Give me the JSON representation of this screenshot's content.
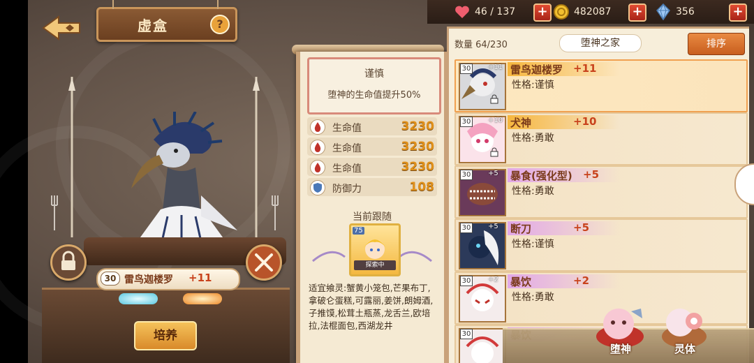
{
  "header": {
    "title": "虚盒",
    "help_glyph": "?"
  },
  "resources": [
    {
      "name": "stamina",
      "icon": "heart-icon",
      "value": "46 / 137",
      "color": "#ef5e6e"
    },
    {
      "name": "gold",
      "icon": "coin-icon",
      "value": "482087",
      "color": "#f2c030"
    },
    {
      "name": "crystal",
      "icon": "crystal-icon",
      "value": "356",
      "color": "#9ec8f4"
    }
  ],
  "character": {
    "level": "30",
    "name": "雷鸟迦楼罗",
    "plus": "+11",
    "train_label": "培养"
  },
  "detail": {
    "trait_name": "谨慎",
    "trait_desc": "堕神的生命值提升50%",
    "stats": [
      {
        "label": "生命值",
        "value": "3230",
        "icon": "blood-drop-icon"
      },
      {
        "label": "生命值",
        "value": "3230",
        "icon": "blood-drop-icon"
      },
      {
        "label": "生命值",
        "value": "3230",
        "icon": "blood-drop-icon"
      },
      {
        "label": "防御力",
        "value": "108",
        "icon": "shield-icon"
      }
    ],
    "follow_label": "当前跟随",
    "follow_level": "75",
    "follow_status": "探索中",
    "favor_text": "适宜飨灵:蟹黄小笼包,芒果布丁,拿破仑蛋糕,可露丽,姜饼,朗姆酒,子推馍,松茸土瓶蒸,龙舌兰,欧培拉,法棍面包,西湖龙井"
  },
  "list": {
    "count": "数量 64/230",
    "tab": "堕神之家",
    "sort_label": "排序",
    "items": [
      {
        "level": "30",
        "plus": "+11",
        "name": "雷鸟迦楼罗",
        "personality": "性格:谨慎",
        "color": "orange",
        "selected": true
      },
      {
        "level": "30",
        "plus": "+10",
        "name": "犬神",
        "personality": "性格:勇敢",
        "color": "orange",
        "selected": false
      },
      {
        "level": "30",
        "plus": "+5",
        "name": "暴食(强化型)",
        "personality": "性格:勇敢",
        "color": "purple",
        "selected": false
      },
      {
        "level": "30",
        "plus": "+5",
        "name": "断刀",
        "personality": "性格:谨慎",
        "color": "purple",
        "selected": false
      },
      {
        "level": "30",
        "plus": "+2",
        "name": "暴饮",
        "personality": "性格:勇敢",
        "color": "purple",
        "selected": false
      },
      {
        "level": "30",
        "plus": "",
        "name": "暴饮",
        "personality": "",
        "color": "purple",
        "selected": false
      }
    ]
  },
  "bottom_nav": {
    "deity_label": "堕神",
    "spirit_label": "灵体"
  }
}
